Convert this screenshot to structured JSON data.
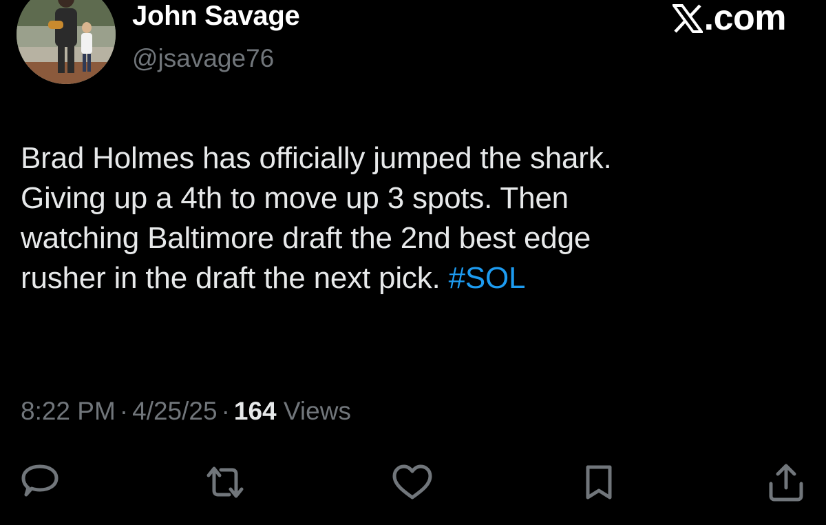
{
  "author": {
    "display_name": "John Savage",
    "handle": "@jsavage76"
  },
  "brand": {
    "text": ".com",
    "icon": "x-logo-icon"
  },
  "tweet": {
    "lines": [
      "Brad Holmes has officially jumped the shark.",
      "Giving up a 4th to move up 3 spots. Then",
      "watching Baltimore draft the 2nd best edge",
      "rusher in the draft the next pick. "
    ],
    "hashtag": "#SOL"
  },
  "meta": {
    "time": "8:22 PM",
    "separator": "·",
    "date": "4/25/25",
    "views_count": "164",
    "views_label": "Views"
  },
  "actions": [
    {
      "name": "reply",
      "icon": "speech-bubble-icon"
    },
    {
      "name": "repost",
      "icon": "repost-arrows-icon"
    },
    {
      "name": "like",
      "icon": "heart-icon"
    },
    {
      "name": "bookmark",
      "icon": "bookmark-icon"
    },
    {
      "name": "share",
      "icon": "share-upload-icon"
    }
  ],
  "colors": {
    "background": "#000000",
    "text": "#e7e9ea",
    "secondary": "#71767b",
    "link": "#1d9bf0",
    "icon": "#71767b"
  }
}
